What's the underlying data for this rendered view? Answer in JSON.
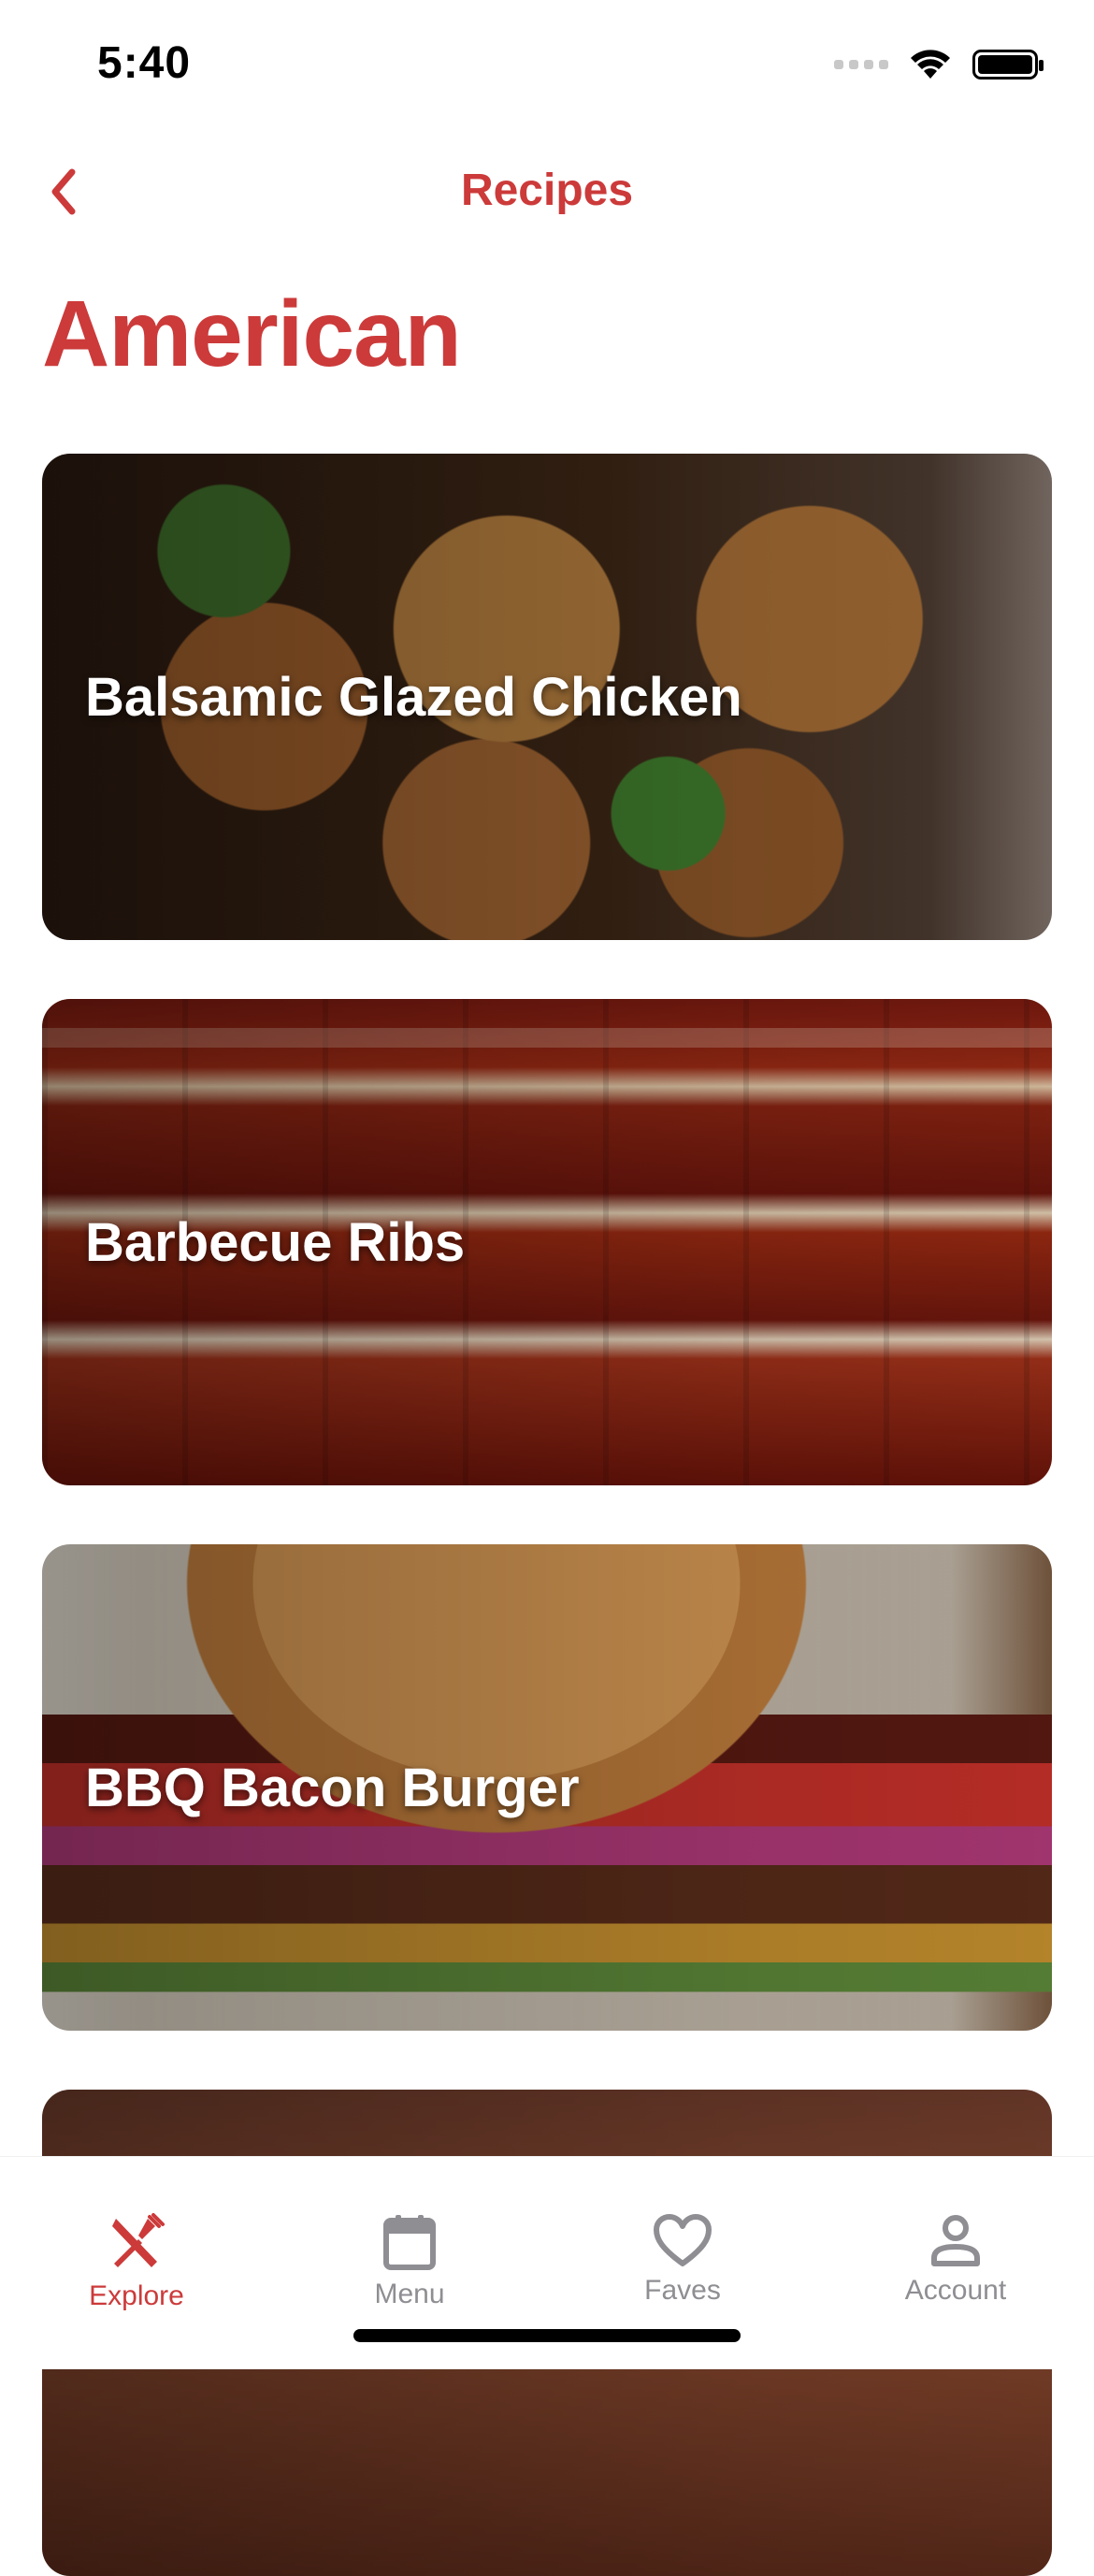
{
  "status_bar": {
    "time": "5:40"
  },
  "nav": {
    "back_label": "Recipes",
    "title": "Recipes"
  },
  "page": {
    "title": "American"
  },
  "recipes": [
    {
      "name": "Balsamic Glazed Chicken"
    },
    {
      "name": "Barbecue Ribs"
    },
    {
      "name": "BBQ Bacon Burger"
    },
    {
      "name": ""
    }
  ],
  "tabs": [
    {
      "label": "Explore",
      "icon": "fork-knife-icon",
      "active": true
    },
    {
      "label": "Menu",
      "icon": "calendar-icon",
      "active": false
    },
    {
      "label": "Faves",
      "icon": "heart-icon",
      "active": false
    },
    {
      "label": "Account",
      "icon": "person-icon",
      "active": false
    }
  ],
  "colors": {
    "accent": "#cc3a3a",
    "inactive": "#8e8e93"
  }
}
